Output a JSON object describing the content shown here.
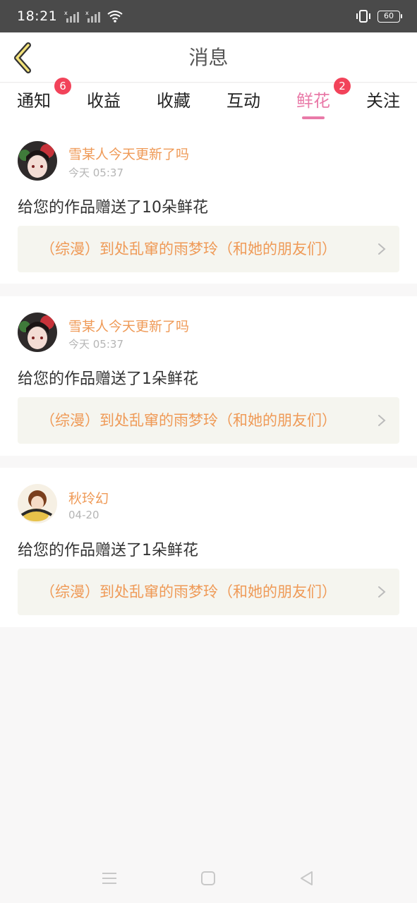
{
  "status_bar": {
    "time": "18:21",
    "battery": "60"
  },
  "header": {
    "title": "消息",
    "back_icon": "chevron-left-icon"
  },
  "tabs": [
    {
      "label": "通知",
      "badge": "6",
      "active": false
    },
    {
      "label": "收益",
      "badge": null,
      "active": false
    },
    {
      "label": "收藏",
      "badge": null,
      "active": false
    },
    {
      "label": "互动",
      "badge": null,
      "active": false
    },
    {
      "label": "鲜花",
      "badge": "2",
      "active": true
    },
    {
      "label": "关注",
      "badge": null,
      "active": false
    }
  ],
  "messages": [
    {
      "username": "雪某人今天更新了吗",
      "time": "今天 05:37",
      "text": "给您的作品赠送了10朵鲜花",
      "work_title": "（综漫）到处乱窜的雨梦玲（和她的朋友们）"
    },
    {
      "username": "雪某人今天更新了吗",
      "time": "今天 05:37",
      "text": "给您的作品赠送了1朵鲜花",
      "work_title": "（综漫）到处乱窜的雨梦玲（和她的朋友们）"
    },
    {
      "username": "秋玲幻",
      "time": "04-20",
      "text": "给您的作品赠送了1朵鲜花",
      "work_title": "（综漫）到处乱窜的雨梦玲（和她的朋友们）"
    }
  ],
  "colors": {
    "accent_pink": "#e97aa8",
    "username_orange": "#ef9a57",
    "badge_red": "#f2435a"
  }
}
